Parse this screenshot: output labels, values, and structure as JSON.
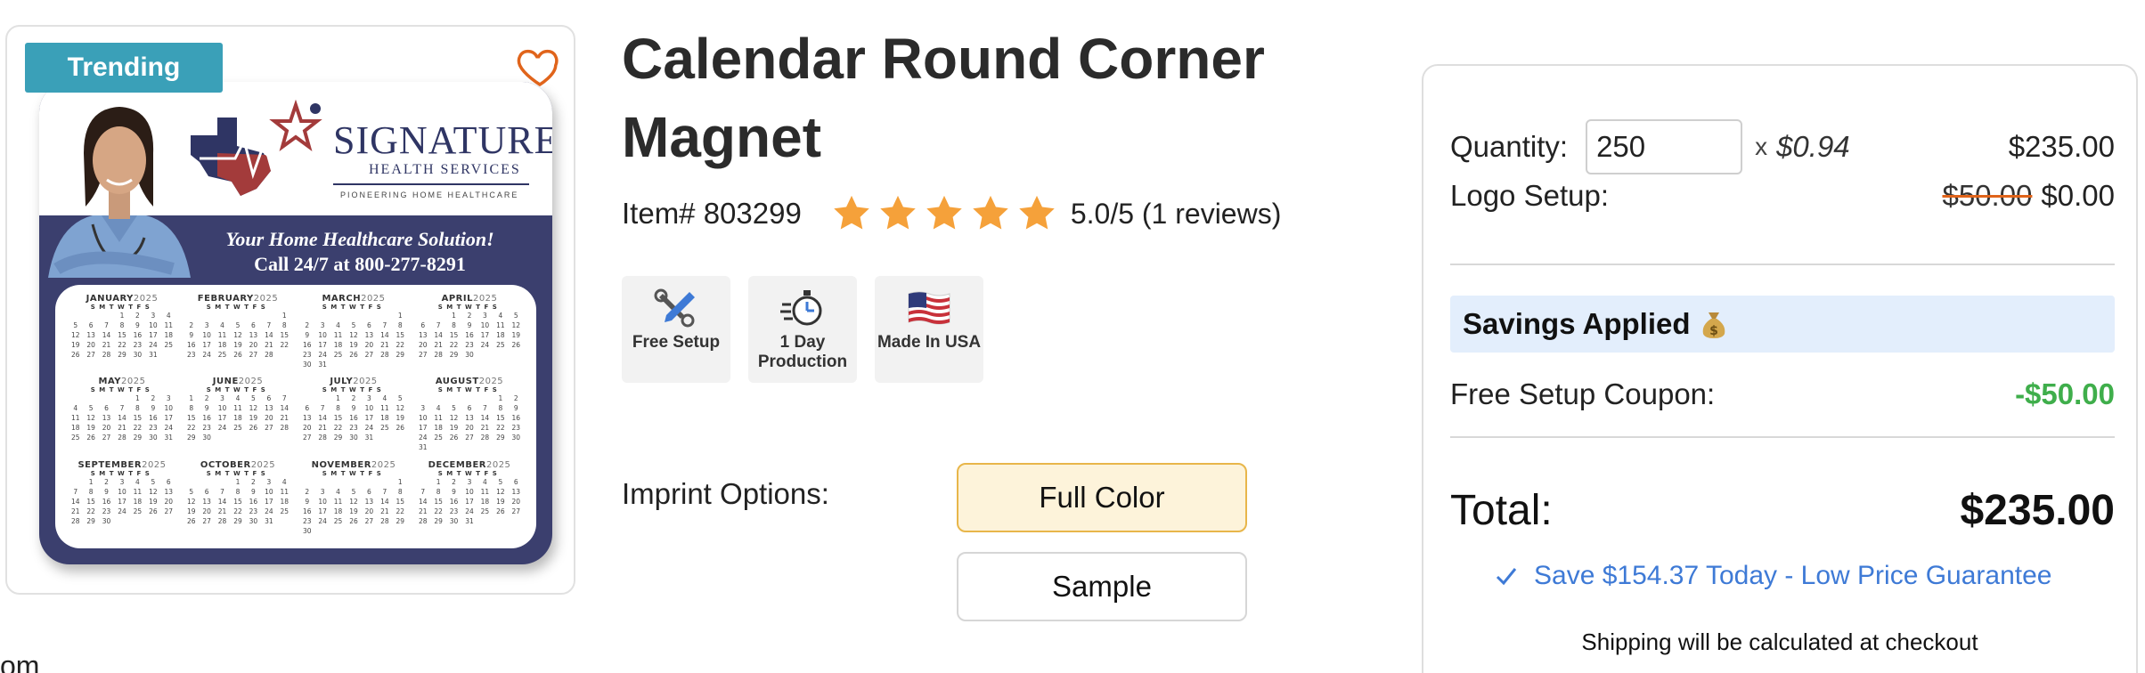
{
  "product": {
    "badge": "Trending",
    "favorite_icon": "heart-outline-icon",
    "title": "Calendar Round Corner Magnet",
    "item_number": "Item# 803299",
    "rating_value": 5.0,
    "rating_max": 5,
    "rating_text": "5.0/5 (1 reviews)",
    "star_color": "#f5a13a"
  },
  "magnet_art": {
    "brand_name": "SIGNATURE",
    "brand_sub": "HEALTH SERVICES",
    "brand_tagline": "PIONEERING HOME HEALTHCARE",
    "slogan": "Your Home Healthcare Solution!",
    "phone_line": "Call 24/7 at 800-277-8291",
    "year": "2025",
    "dow_header": "SMTWTFS",
    "months": [
      {
        "name": "JANUARY",
        "offset": 3,
        "days": 31
      },
      {
        "name": "FEBRUARY",
        "offset": 6,
        "days": 28
      },
      {
        "name": "MARCH",
        "offset": 6,
        "days": 31
      },
      {
        "name": "APRIL",
        "offset": 2,
        "days": 30
      },
      {
        "name": "MAY",
        "offset": 4,
        "days": 31
      },
      {
        "name": "JUNE",
        "offset": 0,
        "days": 30
      },
      {
        "name": "JULY",
        "offset": 2,
        "days": 31
      },
      {
        "name": "AUGUST",
        "offset": 5,
        "days": 31
      },
      {
        "name": "SEPTEMBER",
        "offset": 1,
        "days": 30
      },
      {
        "name": "OCTOBER",
        "offset": 3,
        "days": 31
      },
      {
        "name": "NOVEMBER",
        "offset": 6,
        "days": 30
      },
      {
        "name": "DECEMBER",
        "offset": 1,
        "days": 31
      }
    ]
  },
  "features": [
    {
      "icon": "tools-icon",
      "label": "Free Setup"
    },
    {
      "icon": "stopwatch-icon",
      "label": "1 Day Production"
    },
    {
      "icon": "us-flag-icon",
      "label": "Made In USA"
    }
  ],
  "imprint": {
    "label": "Imprint Options:",
    "options": [
      "Full Color",
      "Sample"
    ],
    "selected": "Full Color"
  },
  "left_fragment": "om",
  "pricing": {
    "quantity_label": "Quantity:",
    "quantity_value": "250",
    "times": "x",
    "unit_price": "$0.94",
    "quantity_total": "$235.00",
    "logo_setup_label": "Logo Setup:",
    "logo_setup_original": "$50.00",
    "logo_setup_price": "$0.00",
    "savings_label": "Savings Applied",
    "savings_icon": "money-bag-icon",
    "coupon_label": "Free Setup Coupon:",
    "coupon_value": "-$50.00",
    "total_label": "Total:",
    "total_value": "$235.00",
    "guarantee": "Save $154.37 Today - Low Price Guarantee",
    "shipping_note": "Shipping will be calculated at checkout",
    "coupon_color": "#3fae4b",
    "guarantee_color": "#3e7ad6"
  }
}
